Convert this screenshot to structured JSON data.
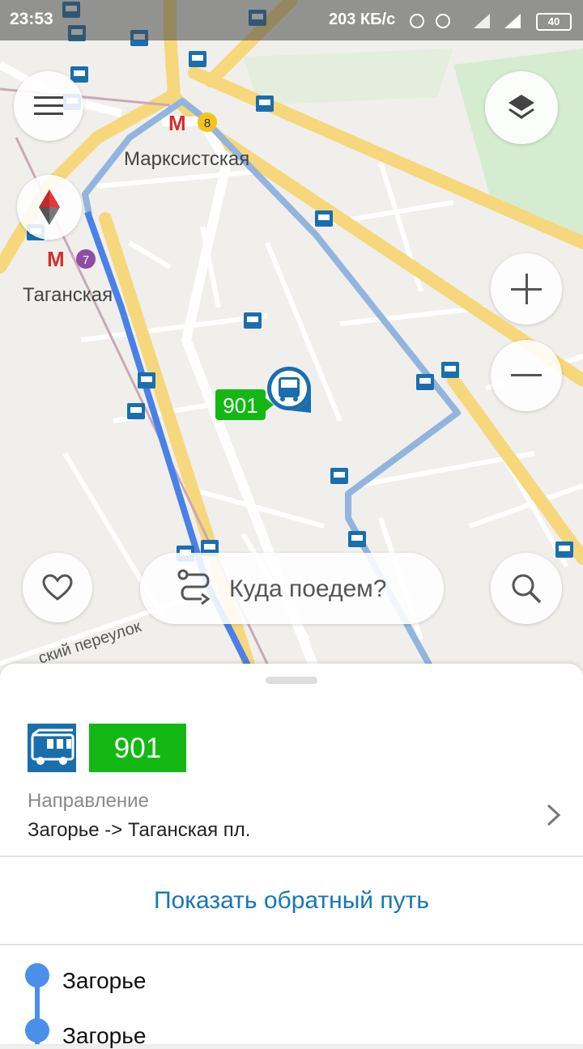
{
  "status_bar": {
    "time": "23:53",
    "network_speed": "203 КБ/с",
    "battery": "40"
  },
  "map": {
    "labels": {
      "station_1": "Марксистская",
      "station_2": "Таганская",
      "street": "ский переулок"
    },
    "metro_lines": {
      "line_a": "8",
      "line_b": "7"
    },
    "metro_symbol": "М",
    "bus_route_marker": "901"
  },
  "search": {
    "placeholder": "Куда поедем?"
  },
  "route_panel": {
    "route_number": "901",
    "direction_label": "Направление",
    "direction_value": "Загорье -> Таганская пл.",
    "reverse_button": "Показать обратный путь",
    "stops": [
      "Загорье",
      "Загорье"
    ]
  },
  "colors": {
    "route_green": "#13b814",
    "link_blue": "#1677b5",
    "route_line_blue": "#4a90e8",
    "bus_blue": "#1a6eae"
  },
  "icons": [
    "menu-icon",
    "layers-icon",
    "compass-icon",
    "zoom-in-icon",
    "zoom-out-icon",
    "heart-icon",
    "route-icon",
    "search-icon",
    "bus-icon",
    "chevron-right-icon"
  ]
}
